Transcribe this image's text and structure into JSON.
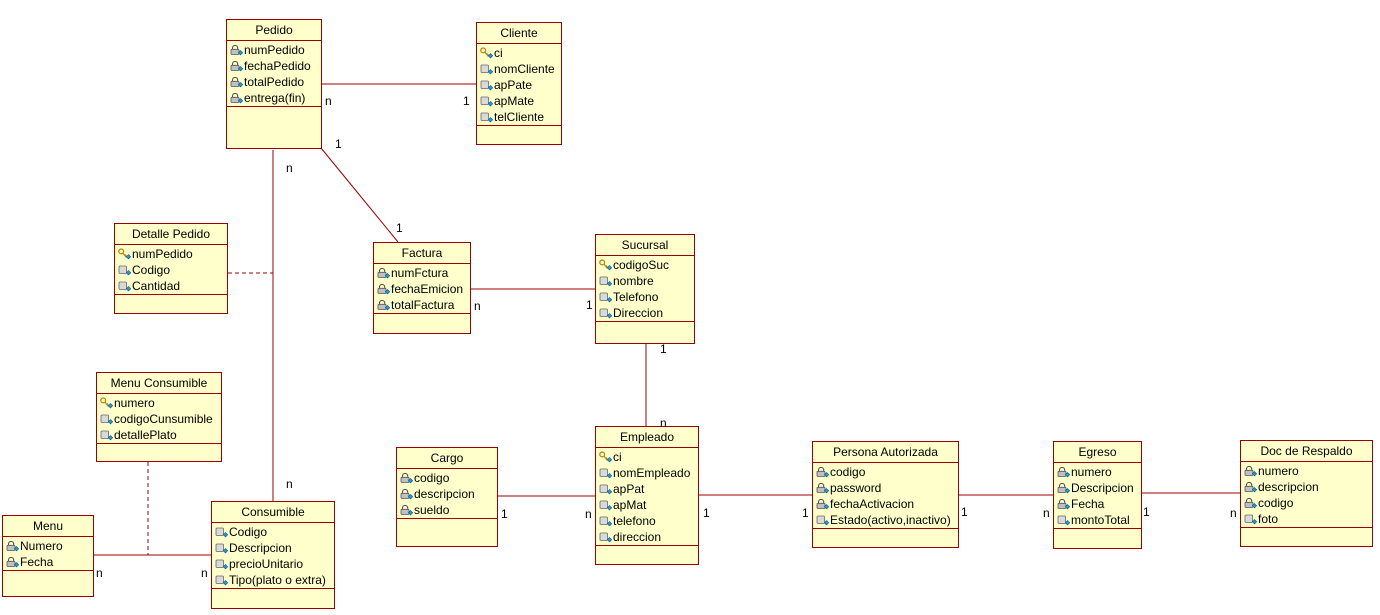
{
  "classes": [
    {
      "id": "pedido",
      "title": "Pedido",
      "attributes": [
        {
          "name": "numPedido",
          "icon": "lock-attribute-icon"
        },
        {
          "name": "fechaPedido",
          "icon": "lock-attribute-icon"
        },
        {
          "name": "totalPedido",
          "icon": "lock-attribute-icon"
        },
        {
          "name": "entrega(fin)",
          "icon": "lock-attribute-icon"
        }
      ]
    },
    {
      "id": "cliente",
      "title": "Cliente",
      "attributes": [
        {
          "name": "ci",
          "icon": "key-attribute-icon"
        },
        {
          "name": "nomCliente",
          "icon": "attribute-icon"
        },
        {
          "name": "apPate",
          "icon": "attribute-icon"
        },
        {
          "name": "apMate",
          "icon": "attribute-icon"
        },
        {
          "name": "telCliente",
          "icon": "attribute-icon"
        }
      ]
    },
    {
      "id": "detalle_pedido",
      "title": "Detalle Pedido",
      "attributes": [
        {
          "name": "numPedido",
          "icon": "key-attribute-icon"
        },
        {
          "name": "Codigo",
          "icon": "attribute-icon"
        },
        {
          "name": "Cantidad",
          "icon": "attribute-icon"
        }
      ]
    },
    {
      "id": "factura",
      "title": "Factura",
      "attributes": [
        {
          "name": "numFctura",
          "icon": "lock-attribute-icon"
        },
        {
          "name": "fechaEmicion",
          "icon": "lock-attribute-icon"
        },
        {
          "name": "totalFactura",
          "icon": "lock-attribute-icon"
        }
      ]
    },
    {
      "id": "sucursal",
      "title": "Sucursal",
      "attributes": [
        {
          "name": "codigoSuc",
          "icon": "key-attribute-icon"
        },
        {
          "name": "nombre",
          "icon": "attribute-icon"
        },
        {
          "name": "Telefono",
          "icon": "attribute-icon"
        },
        {
          "name": "Direccion",
          "icon": "attribute-icon"
        }
      ]
    },
    {
      "id": "menu_consumible",
      "title": "Menu Consumible",
      "attributes": [
        {
          "name": "numero",
          "icon": "key-attribute-icon"
        },
        {
          "name": "codigoCunsumible",
          "icon": "attribute-icon"
        },
        {
          "name": "detallePlato",
          "icon": "attribute-icon"
        }
      ]
    },
    {
      "id": "cargo",
      "title": "Cargo",
      "attributes": [
        {
          "name": "codigo",
          "icon": "lock-attribute-icon"
        },
        {
          "name": "descripcion",
          "icon": "lock-attribute-icon"
        },
        {
          "name": "sueldo",
          "icon": "lock-attribute-icon"
        }
      ]
    },
    {
      "id": "empleado",
      "title": "Empleado",
      "attributes": [
        {
          "name": "ci",
          "icon": "key-attribute-icon"
        },
        {
          "name": "nomEmpleado",
          "icon": "attribute-icon"
        },
        {
          "name": "apPat",
          "icon": "attribute-icon"
        },
        {
          "name": "apMat",
          "icon": "attribute-icon"
        },
        {
          "name": "telefono",
          "icon": "attribute-icon"
        },
        {
          "name": "direccion",
          "icon": "attribute-icon"
        }
      ]
    },
    {
      "id": "persona_autorizada",
      "title": "Persona Autorizada",
      "attributes": [
        {
          "name": "codigo",
          "icon": "lock-attribute-icon"
        },
        {
          "name": "password",
          "icon": "lock-attribute-icon"
        },
        {
          "name": "fechaActivacion",
          "icon": "lock-attribute-icon"
        },
        {
          "name": "Estado(activo,inactivo)",
          "icon": "attribute-icon"
        }
      ]
    },
    {
      "id": "egreso",
      "title": "Egreso",
      "attributes": [
        {
          "name": "numero",
          "icon": "lock-attribute-icon"
        },
        {
          "name": "Descripcion",
          "icon": "lock-attribute-icon"
        },
        {
          "name": "Fecha",
          "icon": "lock-attribute-icon"
        },
        {
          "name": "montoTotal",
          "icon": "attribute-icon"
        }
      ]
    },
    {
      "id": "doc_respaldo",
      "title": "Doc de Respaldo",
      "attributes": [
        {
          "name": "numero",
          "icon": "lock-attribute-icon"
        },
        {
          "name": "descripcion",
          "icon": "lock-attribute-icon"
        },
        {
          "name": "codigo",
          "icon": "lock-attribute-icon"
        },
        {
          "name": "foto",
          "icon": "attribute-icon"
        }
      ]
    },
    {
      "id": "menu",
      "title": "Menu",
      "attributes": [
        {
          "name": "Numero",
          "icon": "lock-attribute-icon"
        },
        {
          "name": "Fecha",
          "icon": "lock-attribute-icon"
        }
      ]
    },
    {
      "id": "consumible",
      "title": "Consumible",
      "attributes": [
        {
          "name": "Codigo",
          "icon": "attribute-icon"
        },
        {
          "name": "Descripcion",
          "icon": "attribute-icon"
        },
        {
          "name": "precioUnitario",
          "icon": "attribute-icon"
        },
        {
          "name": "Tipo(plato o extra)",
          "icon": "attribute-icon"
        }
      ]
    }
  ],
  "associations": [
    {
      "from": "pedido",
      "to": "cliente",
      "from_mult": "n",
      "to_mult": "1"
    },
    {
      "from": "pedido",
      "to": "factura",
      "from_mult": "1",
      "to_mult": "1"
    },
    {
      "from": "pedido",
      "to": "consumible",
      "from_mult": "n",
      "to_mult": "n"
    },
    {
      "from": "factura",
      "to": "sucursal",
      "from_mult": "n",
      "to_mult": "1"
    },
    {
      "from": "sucursal",
      "to": "empleado",
      "from_mult": "1",
      "to_mult": "n"
    },
    {
      "from": "cargo",
      "to": "empleado",
      "from_mult": "1",
      "to_mult": "n"
    },
    {
      "from": "empleado",
      "to": "persona_autorizada",
      "from_mult": "1",
      "to_mult": "1"
    },
    {
      "from": "persona_autorizada",
      "to": "egreso",
      "from_mult": "1",
      "to_mult": "n"
    },
    {
      "from": "egreso",
      "to": "doc_respaldo",
      "from_mult": "1",
      "to_mult": "n"
    },
    {
      "from": "menu",
      "to": "consumible",
      "from_mult": "n",
      "to_mult": "n"
    }
  ],
  "association_classes": [
    {
      "class": "detalle_pedido",
      "on": "pedido-consumible"
    },
    {
      "class": "menu_consumible",
      "on": "menu-consumible"
    }
  ],
  "colors": {
    "fill": "#ffffcc",
    "border": "#990000",
    "line": "#990000"
  }
}
